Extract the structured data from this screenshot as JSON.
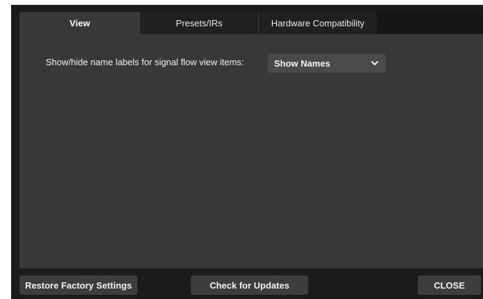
{
  "tabs": {
    "view": "View",
    "presets": "Presets/IRs",
    "hardware": "Hardware Compatibility"
  },
  "view_settings": {
    "name_labels_label": "Show/hide name labels for signal flow view items:",
    "name_labels_value": "Show Names"
  },
  "footer": {
    "restore_label": "Restore Factory Settings",
    "updates_label": "Check for Updates",
    "close_label": "CLOSE"
  },
  "colors": {
    "background": "#1b1b1b",
    "panel": "#383838",
    "button": "#3d3d3d",
    "text": "#f0f0f0"
  }
}
